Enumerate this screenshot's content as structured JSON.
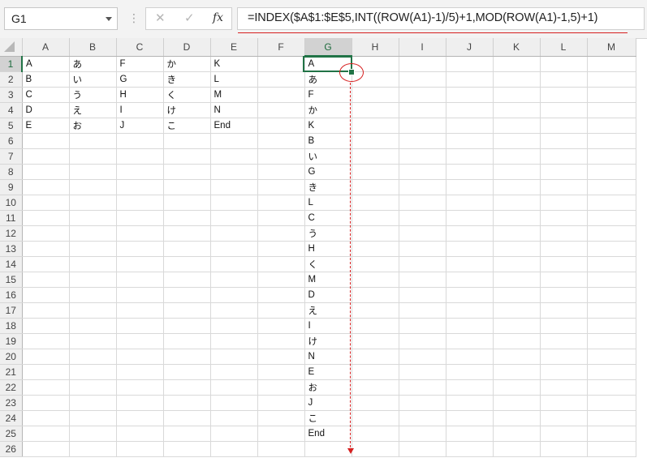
{
  "formula_bar": {
    "name_box": "G1",
    "formula": "=INDEX($A$1:$E$5,INT((ROW(A1)-1)/5)+1,MOD(ROW(A1)-1,5)+1)",
    "cancel_icon": "cancel-icon",
    "enter_icon": "enter-icon",
    "fx_icon": "fx-icon"
  },
  "grid": {
    "columns": [
      "A",
      "B",
      "C",
      "D",
      "E",
      "F",
      "G",
      "H",
      "I",
      "J",
      "K",
      "L",
      "M"
    ],
    "rows": [
      [
        "A",
        "あ",
        "F",
        "か",
        "K",
        "",
        "A"
      ],
      [
        "B",
        "い",
        "G",
        "き",
        "L",
        "",
        "あ"
      ],
      [
        "C",
        "う",
        "H",
        "く",
        "M",
        "",
        "F"
      ],
      [
        "D",
        "え",
        "I",
        "け",
        "N",
        "",
        "か"
      ],
      [
        "E",
        "お",
        "J",
        "こ",
        "End",
        "",
        "K"
      ],
      [
        "",
        "",
        "",
        "",
        "",
        "",
        "B"
      ],
      [
        "",
        "",
        "",
        "",
        "",
        "",
        "い"
      ],
      [
        "",
        "",
        "",
        "",
        "",
        "",
        "G"
      ],
      [
        "",
        "",
        "",
        "",
        "",
        "",
        "き"
      ],
      [
        "",
        "",
        "",
        "",
        "",
        "",
        "L"
      ],
      [
        "",
        "",
        "",
        "",
        "",
        "",
        "C"
      ],
      [
        "",
        "",
        "",
        "",
        "",
        "",
        "う"
      ],
      [
        "",
        "",
        "",
        "",
        "",
        "",
        "H"
      ],
      [
        "",
        "",
        "",
        "",
        "",
        "",
        "く"
      ],
      [
        "",
        "",
        "",
        "",
        "",
        "",
        "M"
      ],
      [
        "",
        "",
        "",
        "",
        "",
        "",
        "D"
      ],
      [
        "",
        "",
        "",
        "",
        "",
        "",
        "え"
      ],
      [
        "",
        "",
        "",
        "",
        "",
        "",
        "I"
      ],
      [
        "",
        "",
        "",
        "",
        "",
        "",
        "け"
      ],
      [
        "",
        "",
        "",
        "",
        "",
        "",
        "N"
      ],
      [
        "",
        "",
        "",
        "",
        "",
        "",
        "E"
      ],
      [
        "",
        "",
        "",
        "",
        "",
        "",
        "お"
      ],
      [
        "",
        "",
        "",
        "",
        "",
        "",
        "J"
      ],
      [
        "",
        "",
        "",
        "",
        "",
        "",
        "こ"
      ],
      [
        "",
        "",
        "",
        "",
        "",
        "",
        "End"
      ],
      [
        "",
        "",
        "",
        "",
        "",
        "",
        ""
      ]
    ],
    "selected_cell": "G1",
    "selected_col": "G",
    "selected_row": 1
  },
  "colors": {
    "selection": "#217346",
    "annotation": "#d62020"
  }
}
